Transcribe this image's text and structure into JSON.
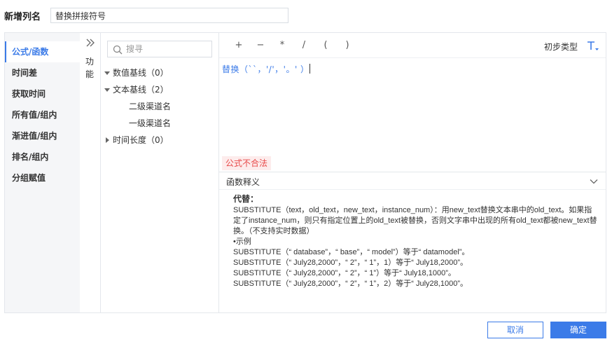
{
  "header": {
    "label": "新增列名",
    "column_name_value": "替换拼接符号"
  },
  "categories": [
    {
      "label": "公式/函数",
      "active": true
    },
    {
      "label": "时间差"
    },
    {
      "label": "获取时间"
    },
    {
      "label": "所有值/组内"
    },
    {
      "label": "渐进值/组内"
    },
    {
      "label": "排名/组内"
    },
    {
      "label": "分组赋值"
    }
  ],
  "function_strip": {
    "label": "功能",
    "icon": "double-chevron-right-icon"
  },
  "search": {
    "placeholder": "搜寻"
  },
  "tree": [
    {
      "label": "数值基线（0）",
      "expanded": true,
      "level": 0
    },
    {
      "label": "文本基线（2）",
      "expanded": true,
      "level": 0
    },
    {
      "label": "二级渠道名",
      "level": 1
    },
    {
      "label": "一级渠道名",
      "level": 1
    },
    {
      "label": "时间长度（0）",
      "expanded": false,
      "level": 0
    }
  ],
  "toolbar": {
    "operators": [
      "+",
      "−",
      "*",
      "/",
      "(",
      ")"
    ],
    "type_label": "初步类型",
    "type_icon": "text-type-icon"
  },
  "formula": {
    "text": "替换（``，'/'，'。' ）"
  },
  "error": {
    "text": "公式不合法"
  },
  "explanation": {
    "header": "函数释义",
    "function_name": "代替：",
    "description": "SUBSTITUTE（text，old_text，new_text，instance_num）：用new_text替换文本串中的old_text。如果指定了instance_num，则只有指定位置上的old_text被替换，否则文字串中出现的所有old_text都被new_text替换。（不支持实时数据）",
    "example_title": "•示例",
    "examples": [
      "SUBSTITUTE（“ database”，“ base”，“ model”）等于“ datamodel”。",
      "SUBSTITUTE（“ July28,2000”，“ 2”，“ 1”，1）等于“ July18,2000”。",
      "SUBSTITUTE（“ July28,2000”，“ 2”，“ 1”）等于“ July18,1000”。",
      "SUBSTITUTE（“ July28,2000”，“ 2”，“ 1”，2）等于“ July28,1000”。"
    ]
  },
  "buttons": {
    "cancel": "取消",
    "ok": "确定"
  },
  "colors": {
    "accent": "#3b7be8",
    "error": "#e84a4a",
    "error_bg": "#fdecec"
  }
}
